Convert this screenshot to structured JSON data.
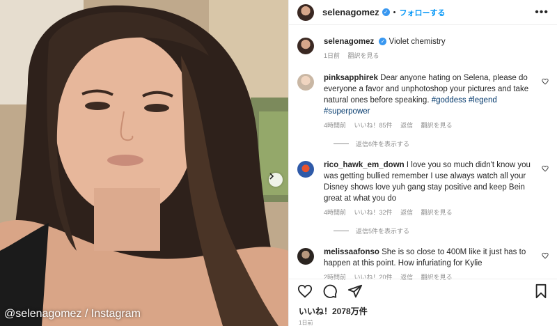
{
  "photo": {
    "watermark": "@selenagomez / Instagram",
    "next_icon": "chevron-right-icon"
  },
  "header": {
    "username": "selenagomez",
    "verified_icon": "verified-badge-icon",
    "separator": "•",
    "follow_label": "フォローする",
    "more_icon": "more-options-icon"
  },
  "caption": {
    "username": "selenagomez",
    "text": "Violet chemistry",
    "time": "1日前",
    "translate": "翻訳を見る"
  },
  "comments": [
    {
      "username": "pinksapphirek",
      "text": "Dear anyone hating on Selena, please do everyone a favor and unphotoshop your pictures and take natural ones before speaking.",
      "tags": [
        "#goddess",
        "#legend",
        "#superpower"
      ],
      "time": "4時間前",
      "likes": "いいね！85件",
      "reply": "返信",
      "translate": "翻訳を見る",
      "replies": "返信6件を表示する"
    },
    {
      "username": "rico_hawk_em_down",
      "text": "I love you so much didn't know you was getting bullied remember I use always watch all your Disney shows love yuh gang stay positive and keep Bein great at what you do",
      "time": "4時間前",
      "likes": "いいね！32件",
      "reply": "返信",
      "translate": "翻訳を見る",
      "replies": "返信5件を表示する"
    },
    {
      "username": "melissaafonso",
      "text": "She is so close to 400M like it just has to happen at this point. How infuriating for Kylie",
      "time": "2時間前",
      "likes": "いいね！20件",
      "reply": "返信",
      "translate": "翻訳を見る"
    }
  ],
  "actions": {
    "like_icon": "heart-icon",
    "comment_icon": "comment-icon",
    "share_icon": "share-icon",
    "save_icon": "bookmark-icon"
  },
  "footer": {
    "likes": "いいね！2078万件",
    "date": "1日前"
  },
  "colors": {
    "link": "#0095f6",
    "hashtag": "#00376b",
    "muted": "#8e8e8e"
  }
}
